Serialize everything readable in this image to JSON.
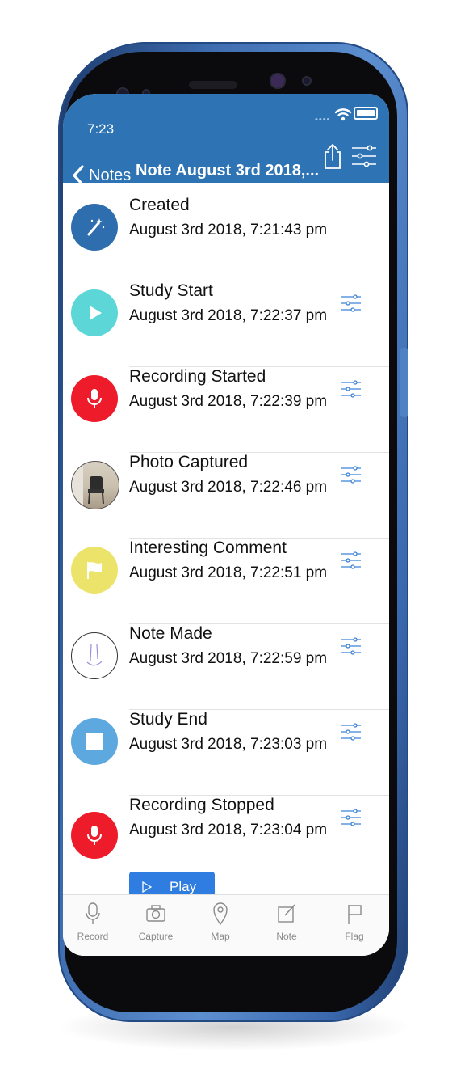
{
  "status_bar": {
    "time": "7:23",
    "dots": "••••"
  },
  "nav": {
    "back_label": "Notes",
    "title": "Note August 3rd 2018,..."
  },
  "events": [
    {
      "title": "Created",
      "date": "August 3rd 2018, 7:21:43 pm",
      "icon": "magic-wand-icon",
      "color": "#2e6eaf",
      "has_options": false
    },
    {
      "title": "Study Start",
      "date": "August 3rd 2018, 7:22:37 pm",
      "icon": "play-icon",
      "color": "#5dd6d8",
      "has_options": true
    },
    {
      "title": "Recording Started",
      "date": "August 3rd 2018, 7:22:39 pm",
      "icon": "microphone-icon",
      "color": "#ee1c2b",
      "has_options": true
    },
    {
      "title": "Photo Captured",
      "date": "August 3rd 2018, 7:22:46 pm",
      "icon": "photo-thumbnail",
      "color": "#b9ad9c",
      "has_options": true
    },
    {
      "title": "Interesting Comment",
      "date": "August 3rd 2018, 7:22:51 pm",
      "icon": "flag-icon",
      "color": "#ece46a",
      "has_options": true
    },
    {
      "title": "Note Made",
      "date": "August 3rd 2018, 7:22:59 pm",
      "icon": "sketch-note-icon",
      "color": "#ffffff",
      "has_options": true
    },
    {
      "title": "Study End",
      "date": "August 3rd 2018, 7:23:03 pm",
      "icon": "stop-icon",
      "color": "#5da8de",
      "has_options": true
    },
    {
      "title": "Recording Stopped",
      "date": "August 3rd 2018, 7:23:04 pm",
      "icon": "microphone-icon",
      "color": "#ee1c2b",
      "has_options": true
    }
  ],
  "play_button": {
    "label": "Play"
  },
  "tabs": [
    {
      "label": "Record",
      "icon": "microphone-outline-icon"
    },
    {
      "label": "Capture",
      "icon": "camera-icon"
    },
    {
      "label": "Map",
      "icon": "map-pin-icon"
    },
    {
      "label": "Note",
      "icon": "compose-icon"
    },
    {
      "label": "Flag",
      "icon": "flag-outline-icon"
    }
  ],
  "colors": {
    "nav_blue": "#2e74b5",
    "accent_blue": "#2f7de0",
    "options_blue": "#3b82d6"
  }
}
